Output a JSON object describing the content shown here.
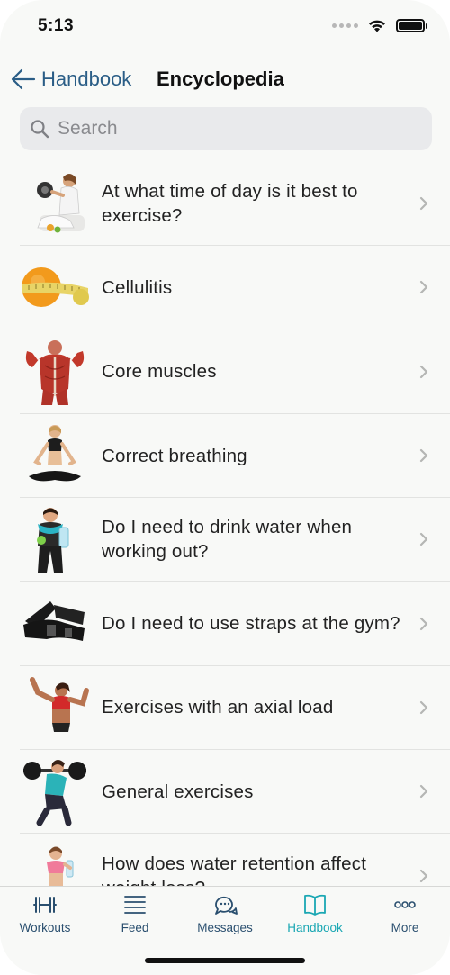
{
  "status": {
    "time": "5:13"
  },
  "nav": {
    "back_label": "Handbook",
    "title": "Encyclopedia"
  },
  "search": {
    "placeholder": "Search",
    "value": ""
  },
  "items": [
    {
      "label": "At what time of day is it best to exercise?",
      "thumb": "woman-with-dumbbell-image"
    },
    {
      "label": "Cellulitis",
      "thumb": "orange-with-measuring-tape-image"
    },
    {
      "label": "Core muscles",
      "thumb": "back-muscles-anatomy-image"
    },
    {
      "label": "Correct breathing",
      "thumb": "woman-meditating-image"
    },
    {
      "label": "Do I need to drink water when working out?",
      "thumb": "woman-drinking-water-image"
    },
    {
      "label": "Do I need to use straps at the gym?",
      "thumb": "lifting-straps-image"
    },
    {
      "label": "Exercises with an axial load",
      "thumb": "woman-flexing-image"
    },
    {
      "label": "General exercises",
      "thumb": "woman-squatting-barbell-image"
    },
    {
      "label": "How does water retention affect weight loss?",
      "thumb": "woman-with-water-bottle-image"
    }
  ],
  "tabs": [
    {
      "label": "Workouts",
      "icon": "dumbbell-icon",
      "active": false
    },
    {
      "label": "Feed",
      "icon": "feed-lines-icon",
      "active": false
    },
    {
      "label": "Messages",
      "icon": "chat-bubbles-icon",
      "active": false
    },
    {
      "label": "Handbook",
      "icon": "open-book-icon",
      "active": true
    },
    {
      "label": "More",
      "icon": "more-dots-icon",
      "active": false
    }
  ],
  "colors": {
    "accent": "#1aa7b3",
    "nav_blue": "#2a5d86",
    "tab_inactive": "#2a4f6f",
    "background": "#f8f9f7"
  }
}
